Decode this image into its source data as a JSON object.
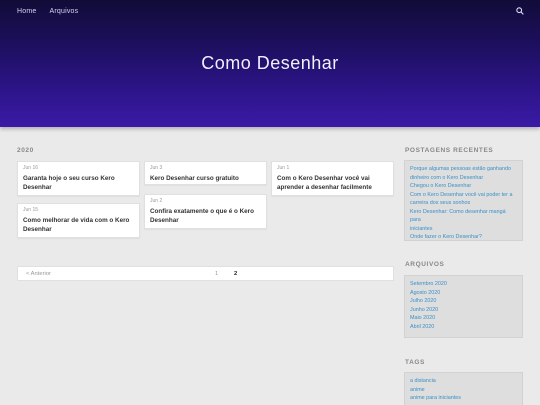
{
  "nav": {
    "items": [
      "Home",
      "Arquivos"
    ]
  },
  "site": {
    "title": "Como Desenhar"
  },
  "archive": {
    "heading": "2020"
  },
  "posts": [
    {
      "date": "Jun 16",
      "title": "Garanta hoje o seu curso Kero Desenhar"
    },
    {
      "date": "Jun 3",
      "title": "Kero Desenhar curso gratuito"
    },
    {
      "date": "Jun 1",
      "title": "Com o Kero Desenhar você vai aprender a desenhar facilmente"
    },
    {
      "date": "Jun 15",
      "title": "Como melhorar de vida com o Kero Desenhar"
    },
    {
      "date": "Jun 2",
      "title": "Confira exatamente o que é o Kero Desenhar"
    }
  ],
  "pagination": {
    "prev": "< Anterior",
    "pages": [
      "1",
      "2"
    ],
    "current": "2"
  },
  "sidebar": {
    "recent": {
      "heading": "POSTAGENS RECENTES",
      "items": [
        "Porque algumas pessoas estão ganhando",
        "dinheiro com o Kero Desenhar",
        "Chegou o Kero Desenhar",
        "Com o Kero Desenhar você vai poder ter a",
        "carreira dos seus sonhos",
        "Kero Desenhar: Como desenhar mangá para",
        "iniciantes",
        "Onde fazer o Kero Desenhar?"
      ]
    },
    "archives": {
      "heading": "ARQUIVOS",
      "items": [
        "Setembro 2020",
        "Agosto 2020",
        "Julho 2020",
        "Junho 2020",
        "Maio 2020",
        "Abril 2020"
      ]
    },
    "tags": {
      "heading": "TAGS",
      "items": [
        "a distancia",
        "anime",
        "anime para iniciantes"
      ]
    }
  },
  "colors": {
    "link": "#3a8fc6",
    "hero_top": "#110c38",
    "hero_bottom": "#3a1aa6"
  }
}
